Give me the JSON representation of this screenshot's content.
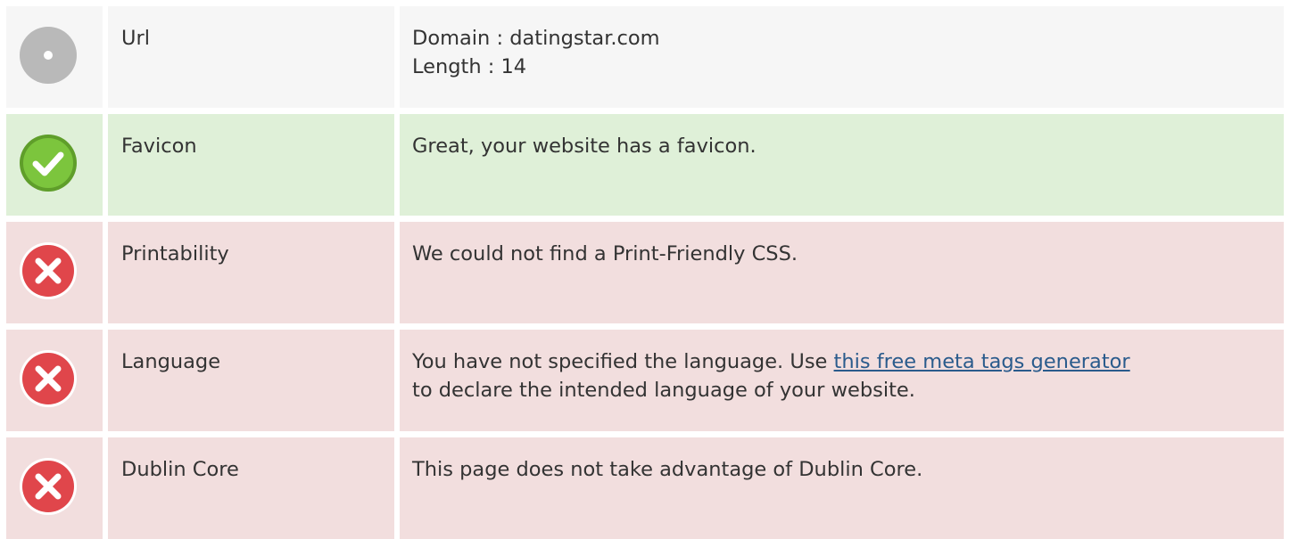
{
  "rows": [
    {
      "status": "neutral",
      "icon": "circle-neutral-icon",
      "label": "Url",
      "lines": [
        "Domain : datingstar.com",
        "Length : 14"
      ]
    },
    {
      "status": "good",
      "icon": "check-icon",
      "label": "Favicon",
      "lines": [
        "Great, your website has a favicon."
      ]
    },
    {
      "status": "bad",
      "icon": "error-x-icon",
      "label": "Printability",
      "lines": [
        "We could not find a Print-Friendly CSS."
      ]
    },
    {
      "status": "bad",
      "icon": "error-x-icon",
      "label": "Language",
      "line1_prefix": "You have not specified the language. Use ",
      "line1_link": "this free meta tags generator",
      "line2": "to declare the intended language of your website."
    },
    {
      "status": "bad",
      "icon": "error-x-icon",
      "label": "Dublin Core",
      "lines": [
        "This page does not take advantage of Dublin Core."
      ]
    }
  ],
  "colors": {
    "neutral_bg": "#f6f6f6",
    "good_bg": "#dff0d8",
    "bad_bg": "#f2dede",
    "link": "#2a5b8c",
    "good_icon": "#7cc53d",
    "bad_icon": "#e0464b",
    "neutral_icon": "#b9b9b9"
  }
}
